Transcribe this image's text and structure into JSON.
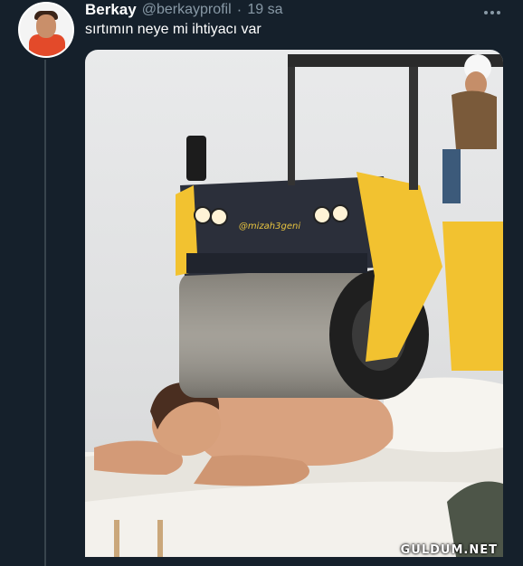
{
  "tweet": {
    "display_name": "Berkay",
    "handle": "@berkayprofil",
    "separator": "·",
    "time": "19 sa",
    "more_icon": "more-horizontal-icon",
    "text": "sırtımın neye mi ihtiyacı var"
  },
  "media": {
    "roller_watermark": "@mizah3geni",
    "site_watermark": "GULDUM.NET"
  },
  "colors": {
    "background": "#15202b",
    "secondary_text": "#8899a6",
    "roller_yellow": "#f2c230"
  }
}
